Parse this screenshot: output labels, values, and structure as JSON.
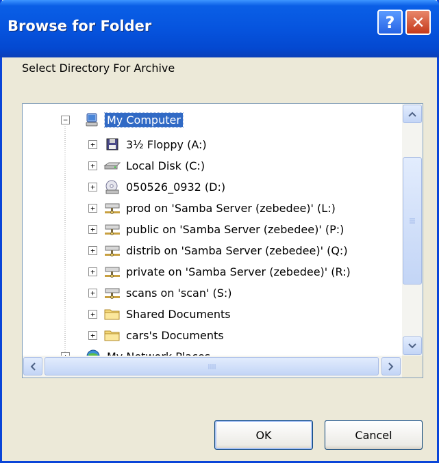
{
  "window": {
    "title": "Browse for Folder",
    "help_glyph": "?",
    "close_glyph": "✕"
  },
  "prompt": "Select Directory For Archive",
  "tree": {
    "root": {
      "label": "My Computer",
      "icon": "my-computer-icon",
      "expander": "−",
      "selected": true
    },
    "items": [
      {
        "label": "3½ Floppy (A:)",
        "icon": "floppy-drive-icon",
        "expander": "+"
      },
      {
        "label": "Local Disk (C:)",
        "icon": "hard-disk-icon",
        "expander": "+"
      },
      {
        "label": "050526_0932 (D:)",
        "icon": "cd-drive-icon",
        "expander": "+"
      },
      {
        "label": "prod on 'Samba Server (zebedee)' (L:)",
        "icon": "network-drive-icon",
        "expander": "+"
      },
      {
        "label": "public on 'Samba Server (zebedee)' (P:)",
        "icon": "network-drive-icon",
        "expander": "+"
      },
      {
        "label": "distrib on 'Samba Server (zebedee)' (Q:)",
        "icon": "network-drive-icon",
        "expander": "+"
      },
      {
        "label": "private on 'Samba Server (zebedee)' (R:)",
        "icon": "network-drive-icon",
        "expander": "+"
      },
      {
        "label": "scans on 'scan' (S:)",
        "icon": "network-drive-icon",
        "expander": "+"
      },
      {
        "label": "Shared Documents",
        "icon": "folder-icon",
        "expander": "+"
      },
      {
        "label": "cars's Documents",
        "icon": "folder-icon",
        "expander": "+"
      }
    ],
    "next_root": {
      "label": "My Network Places",
      "icon": "network-places-icon",
      "expander": "+"
    }
  },
  "buttons": {
    "ok": "OK",
    "cancel": "Cancel"
  },
  "colors": {
    "titlebar": "#0654de",
    "selection": "#316ac5",
    "dialog_bg": "#ece9d8"
  }
}
